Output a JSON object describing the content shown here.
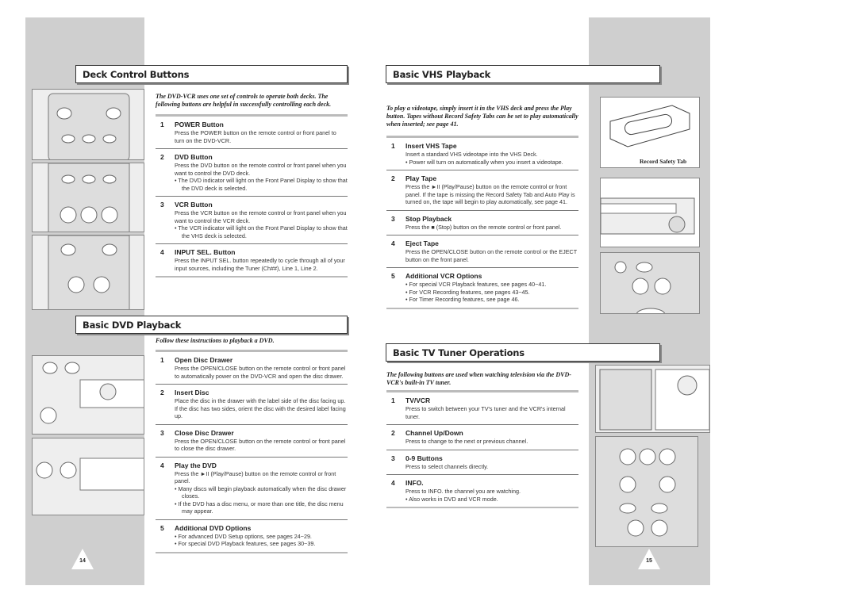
{
  "left_page": {
    "page_number": "14",
    "deck": {
      "heading": "Deck Control Buttons",
      "intro": "The DVD-VCR uses one set of controls to operate both decks. The following buttons are helpful in successfully controlling each deck.",
      "items": [
        {
          "num": "1",
          "title": "POWER Button",
          "desc": "Press the POWER button on the remote control or front panel to turn on the DVD-VCR.",
          "bullets": []
        },
        {
          "num": "2",
          "title": "DVD Button",
          "desc": "Press the DVD button on the remote control or front panel when you want to control the DVD deck.",
          "bullets": [
            "The DVD indicator will light on the Front Panel Display to show that the DVD deck is selected."
          ]
        },
        {
          "num": "3",
          "title": "VCR Button",
          "desc": "Press the VCR button on the remote control or front panel when you want to control the VCR deck.",
          "bullets": [
            "The VCR indicator will light on the Front Panel Display to show that the VHS deck is selected."
          ]
        },
        {
          "num": "4",
          "title": "INPUT SEL. Button",
          "desc": "Press the INPUT SEL. button repeatedly to cycle through all of your input sources, including the  Tuner (Ch##), Line 1, Line 2.",
          "bullets": []
        }
      ]
    },
    "dvd": {
      "heading": "Basic DVD Playback",
      "intro": "Follow these instructions to playback a DVD.",
      "items": [
        {
          "num": "1",
          "title": "Open Disc Drawer",
          "desc": "Press the OPEN/CLOSE button on the remote control or front panel to automatically power on the DVD-VCR and open the disc drawer.",
          "bullets": []
        },
        {
          "num": "2",
          "title": "Insert Disc",
          "desc": "Place the disc in the drawer with the label side of the disc facing up. If the disc has two sides, orient the disc with the desired label facing up.",
          "bullets": []
        },
        {
          "num": "3",
          "title": "Close Disc Drawer",
          "desc": "Press the OPEN/CLOSE button on the remote control or front panel to close the disc drawer.",
          "bullets": []
        },
        {
          "num": "4",
          "title": "Play the DVD",
          "desc": "Press the ►II (Play/Pause) button on the remote control or front panel.",
          "bullets": [
            "Many discs will begin playback automatically when the disc drawer closes.",
            "If the DVD has a disc menu, or more than one title, the disc menu may appear."
          ]
        },
        {
          "num": "5",
          "title": "Additional DVD Options",
          "desc": "",
          "bullets": [
            "For advanced DVD Setup options, see pages 24~29.",
            "For special DVD Playback features, see pages 30~39."
          ]
        }
      ]
    }
  },
  "right_page": {
    "page_number": "15",
    "vhs": {
      "heading": "Basic VHS Playback",
      "intro": "To play a videotape, simply insert it in the VHS deck and press the Play button. Tapes without Record Safety Tabs can be set to play automatically when inserted; see page 41.",
      "image_caption": "Record Safety Tab",
      "items": [
        {
          "num": "1",
          "title": "Insert VHS Tape",
          "desc": "Insert a standard VHS videotape into the VHS Deck.",
          "bullets": [
            "Power will turn on automatically when you insert a videotape."
          ]
        },
        {
          "num": "2",
          "title": "Play Tape",
          "desc": "Press the ►II (Play/Pause) button on the remote control or front panel. If  the tape is missing the Record Safety Tab and Auto Play is turned on, the tape will begin to play automatically, see page 41.",
          "bullets": []
        },
        {
          "num": "3",
          "title": "Stop Playback",
          "desc": "Press the ■ (Stop) button on the remote control or front panel.",
          "bullets": []
        },
        {
          "num": "4",
          "title": "Eject Tape",
          "desc": "Press the OPEN/CLOSE button on the remote control or the EJECT button on the front panel.",
          "bullets": []
        },
        {
          "num": "5",
          "title": "Additional VCR Options",
          "desc": "",
          "bullets": [
            "For special VCR Playback features, see pages 40~41.",
            "For VCR Recording features, see pages 43~45.",
            "For Timer Recording features, see page 46."
          ]
        }
      ]
    },
    "tv": {
      "heading": "Basic TV Tuner Operations",
      "intro": "The following buttons are used when watching television via the DVD-VCR's built-in TV tuner.",
      "items": [
        {
          "num": "1",
          "title": "TV/VCR",
          "desc": "Press to switch between your TV's tuner and the VCR's internal tuner.",
          "bullets": []
        },
        {
          "num": "2",
          "title": "Channel Up/Down",
          "desc": "Press to change to the next or previous channel.",
          "bullets": []
        },
        {
          "num": "3",
          "title": "0-9 Buttons",
          "desc": "Press to select channels directly.",
          "bullets": []
        },
        {
          "num": "4",
          "title": "INFO.",
          "desc": "Press to INFO. the channel you are watching.",
          "bullets": [
            "Also works in DVD and VCR mode."
          ]
        }
      ]
    }
  }
}
